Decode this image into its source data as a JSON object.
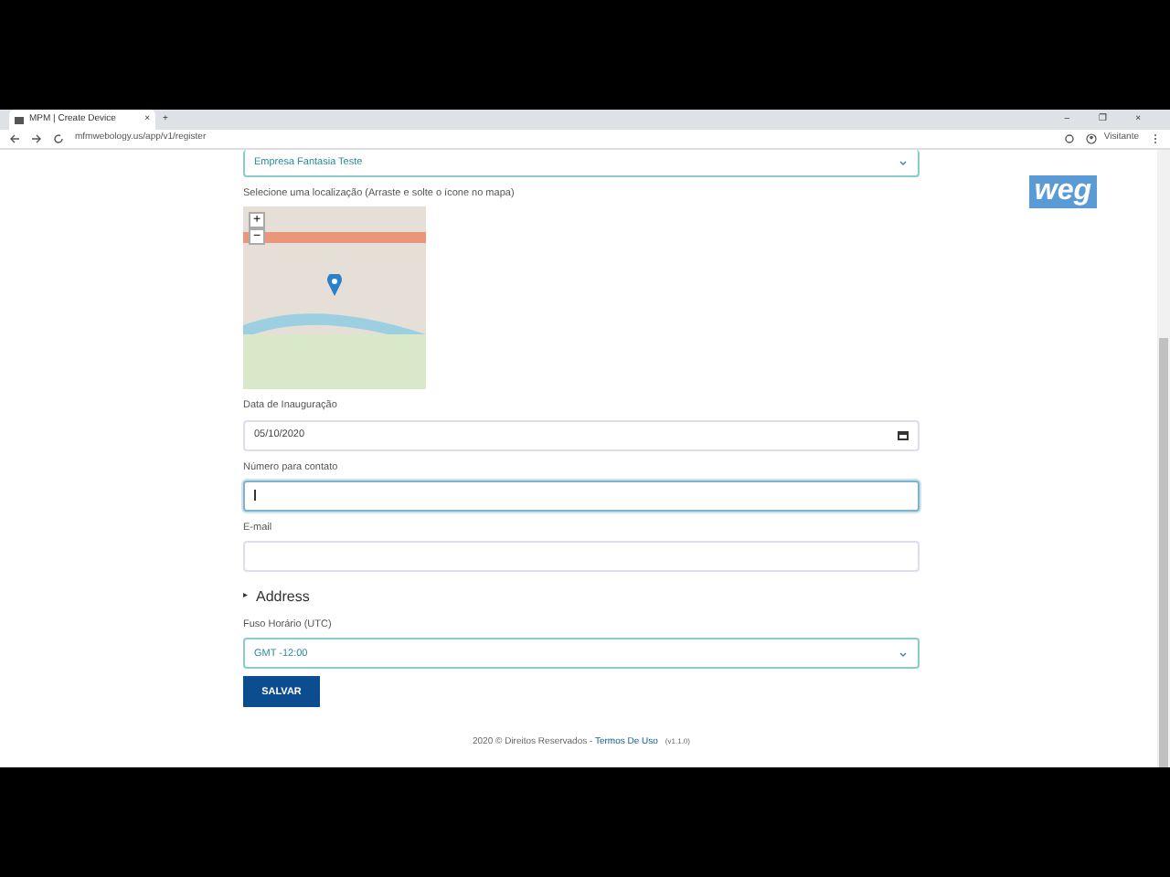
{
  "browser": {
    "tab_title": "MPM | Create Device",
    "tab_close": "×",
    "new_tab": "+",
    "url": "mfmwebology.us/app/v1/register",
    "profile": "Visitante",
    "window_controls": [
      "–",
      "❐",
      "×"
    ]
  },
  "logo": "weg",
  "form": {
    "company_select": {
      "value": "Empresa Fantasia Teste"
    },
    "map": {
      "label": "Selecione uma localização (Arraste e solte o ícone no mapa)",
      "zoom_in": "+",
      "zoom_out": "−"
    },
    "fields": [
      {
        "kind": "date",
        "label": "Data de Inauguração",
        "value": "05/10/2020",
        "focused": false
      },
      {
        "kind": "text",
        "label": "Número para contato",
        "focused": true
      },
      {
        "kind": "text",
        "label": "E-mail",
        "focused": false
      }
    ],
    "address": {
      "marker": "▸",
      "label": "Address",
      "expanded": false
    },
    "timezone": {
      "label": "Fuso Horário (UTC)",
      "value": "GMT -12:00"
    },
    "save_button": "SALVAR"
  },
  "footer": {
    "text": "2020 © Direitos Reservados - ",
    "link": "Termos De Uso",
    "version": "(v1.1.0)"
  }
}
